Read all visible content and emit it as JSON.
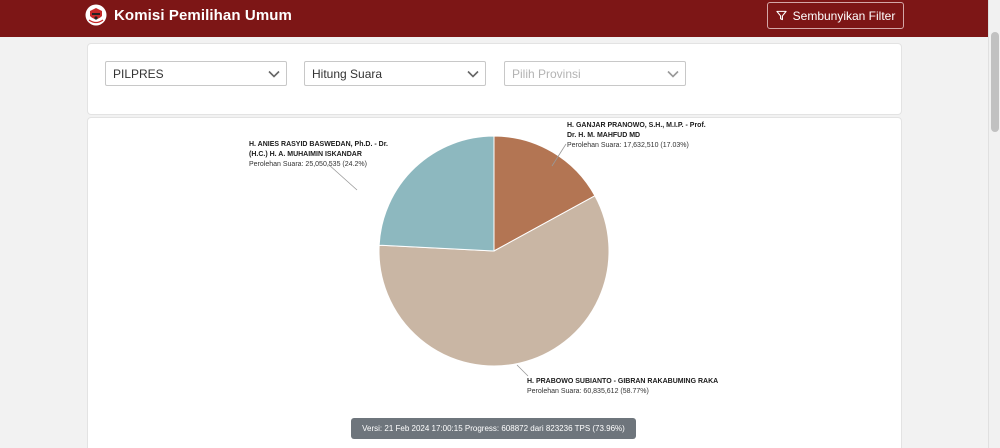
{
  "header": {
    "title": "Komisi Pemilihan Umum",
    "filter_button": "Sembunyikan Filter"
  },
  "filters": {
    "election": "PILPRES",
    "view": "Hitung Suara",
    "province_placeholder": "Pilih Provinsi"
  },
  "chart_data": {
    "type": "pie",
    "slices": [
      {
        "name": "H. ANIES RASYID BASWEDAN, Ph.D. - Dr. (H.C.) H. A. MUHAIMIN ISKANDAR",
        "name_line1": "H. ANIES RASYID BASWEDAN, Ph.D. - Dr.",
        "name_line2": "(H.C.) H. A. MUHAIMIN ISKANDAR",
        "vote_text": "Perolehan Suara: 25,050,535 (24.2%)",
        "votes": 25050535,
        "percent": 24.2,
        "color": "#8db8bf"
      },
      {
        "name": "H. PRABOWO SUBIANTO - GIBRAN RAKABUMING RAKA",
        "name_line1": "H. PRABOWO SUBIANTO - GIBRAN RAKABUMING RAKA",
        "vote_text": "Perolehan Suara: 60,835,612 (58.77%)",
        "votes": 60835612,
        "percent": 58.77,
        "color": "#c9b6a4"
      },
      {
        "name": "H. GANJAR PRANOWO, S.H., M.I.P. - Prof. Dr. H. M. MAHFUD MD",
        "name_line1": "H. GANJAR PRANOWO, S.H., M.I.P. - Prof.",
        "name_line2": "Dr. H. M. MAHFUD MD",
        "vote_text": "Perolehan Suara: 17,632,510 (17.03%)",
        "votes": 17632510,
        "percent": 17.03,
        "color": "#b37553"
      }
    ]
  },
  "footer": {
    "version_text": "Versi: 21 Feb 2024 17:00:15 Progress: 608872 dari 823236 TPS (73.96%)"
  },
  "colors": {
    "navbar": "#7d1616",
    "version_badge": "#6e757c"
  }
}
